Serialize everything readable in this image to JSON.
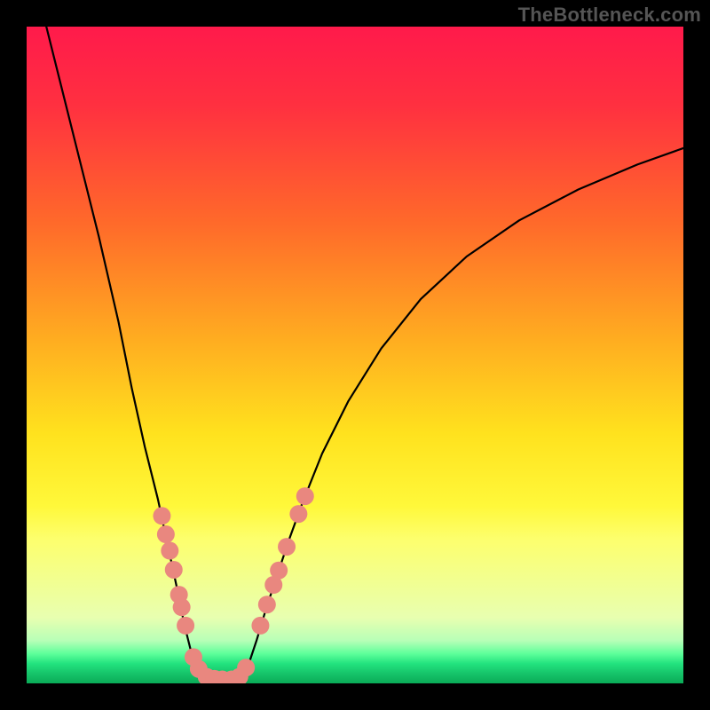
{
  "watermark": "TheBottleneck.com",
  "chart_data": {
    "type": "line",
    "title": "",
    "xlabel": "",
    "ylabel": "",
    "xlim": [
      0,
      100
    ],
    "ylim": [
      0,
      100
    ],
    "background_gradient_stops": [
      {
        "offset": 0.0,
        "color": "#ff1a4b"
      },
      {
        "offset": 0.12,
        "color": "#ff3040"
      },
      {
        "offset": 0.3,
        "color": "#ff6a2a"
      },
      {
        "offset": 0.48,
        "color": "#ffae20"
      },
      {
        "offset": 0.62,
        "color": "#ffe21e"
      },
      {
        "offset": 0.73,
        "color": "#fff83a"
      },
      {
        "offset": 0.78,
        "color": "#fdff6d"
      },
      {
        "offset": 0.9,
        "color": "#e8ffb0"
      },
      {
        "offset": 0.935,
        "color": "#b7ffb7"
      },
      {
        "offset": 0.955,
        "color": "#5dff9a"
      },
      {
        "offset": 0.97,
        "color": "#22e27e"
      },
      {
        "offset": 0.985,
        "color": "#16c46a"
      },
      {
        "offset": 1.0,
        "color": "#0aab57"
      }
    ],
    "series": [
      {
        "name": "bottleneck-curve",
        "stroke": "#000000",
        "stroke_width": 2.2,
        "points": [
          {
            "x": 3.0,
            "y": 100.0
          },
          {
            "x": 5.0,
            "y": 92.0
          },
          {
            "x": 8.0,
            "y": 80.0
          },
          {
            "x": 11.0,
            "y": 68.0
          },
          {
            "x": 14.0,
            "y": 55.0
          },
          {
            "x": 16.0,
            "y": 45.0
          },
          {
            "x": 18.0,
            "y": 36.0
          },
          {
            "x": 20.0,
            "y": 28.0
          },
          {
            "x": 21.5,
            "y": 21.0
          },
          {
            "x": 23.0,
            "y": 14.0
          },
          {
            "x": 24.0,
            "y": 9.0
          },
          {
            "x": 25.0,
            "y": 5.0
          },
          {
            "x": 26.0,
            "y": 2.5
          },
          {
            "x": 27.0,
            "y": 1.2
          },
          {
            "x": 28.0,
            "y": 0.6
          },
          {
            "x": 29.0,
            "y": 0.5
          },
          {
            "x": 30.5,
            "y": 0.5
          },
          {
            "x": 32.0,
            "y": 0.7
          },
          {
            "x": 33.0,
            "y": 1.6
          },
          {
            "x": 34.0,
            "y": 3.5
          },
          {
            "x": 35.0,
            "y": 6.5
          },
          {
            "x": 36.5,
            "y": 11.5
          },
          {
            "x": 38.0,
            "y": 16.0
          },
          {
            "x": 40.0,
            "y": 22.0
          },
          {
            "x": 42.0,
            "y": 27.5
          },
          {
            "x": 45.0,
            "y": 35.0
          },
          {
            "x": 49.0,
            "y": 43.0
          },
          {
            "x": 54.0,
            "y": 51.0
          },
          {
            "x": 60.0,
            "y": 58.5
          },
          {
            "x": 67.0,
            "y": 65.0
          },
          {
            "x": 75.0,
            "y": 70.5
          },
          {
            "x": 84.0,
            "y": 75.2
          },
          {
            "x": 93.0,
            "y": 79.0
          },
          {
            "x": 100.0,
            "y": 81.5
          }
        ]
      }
    ],
    "markers": {
      "name": "highlighted-points",
      "fill": "#e9877f",
      "radius": 10,
      "points": [
        {
          "x": 20.6,
          "y": 25.5
        },
        {
          "x": 21.2,
          "y": 22.7
        },
        {
          "x": 21.8,
          "y": 20.2
        },
        {
          "x": 22.4,
          "y": 17.3
        },
        {
          "x": 23.2,
          "y": 13.5
        },
        {
          "x": 23.6,
          "y": 11.6
        },
        {
          "x": 24.2,
          "y": 8.8
        },
        {
          "x": 25.4,
          "y": 4.0
        },
        {
          "x": 26.2,
          "y": 2.2
        },
        {
          "x": 27.4,
          "y": 1.0
        },
        {
          "x": 28.6,
          "y": 0.7
        },
        {
          "x": 29.8,
          "y": 0.6
        },
        {
          "x": 31.2,
          "y": 0.6
        },
        {
          "x": 32.4,
          "y": 1.0
        },
        {
          "x": 33.4,
          "y": 2.4
        },
        {
          "x": 35.6,
          "y": 8.8
        },
        {
          "x": 36.6,
          "y": 12.0
        },
        {
          "x": 37.6,
          "y": 15.0
        },
        {
          "x": 38.4,
          "y": 17.2
        },
        {
          "x": 39.6,
          "y": 20.8
        },
        {
          "x": 41.4,
          "y": 25.8
        },
        {
          "x": 42.4,
          "y": 28.5
        }
      ]
    }
  }
}
